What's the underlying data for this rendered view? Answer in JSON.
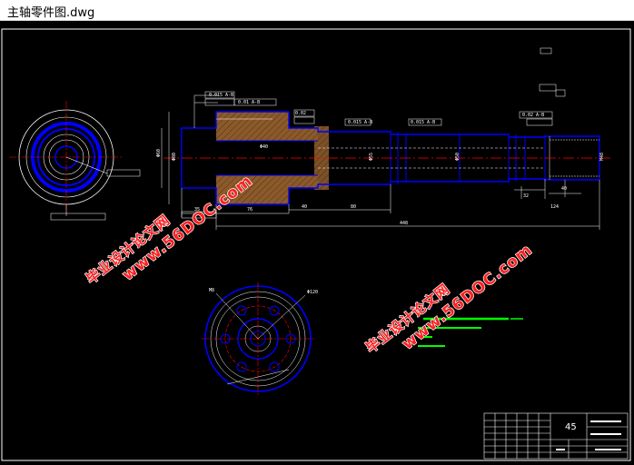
{
  "window": {
    "title": "主轴零件图.dwg"
  },
  "watermarks": [
    {
      "cn": "毕业设计论文网",
      "url": "www.56DOC.com"
    },
    {
      "cn": "毕业设计论文网",
      "url": "www.56DOC.com"
    }
  ],
  "title_block": {
    "material": "45"
  },
  "colors": {
    "background": "#000000",
    "outline": "#0000ff",
    "dimension": "#ffffff",
    "centerline": "#ff0000",
    "hatch": "#8b5a2b",
    "watermark": "#ff2020",
    "annotation": "#00ff00"
  }
}
